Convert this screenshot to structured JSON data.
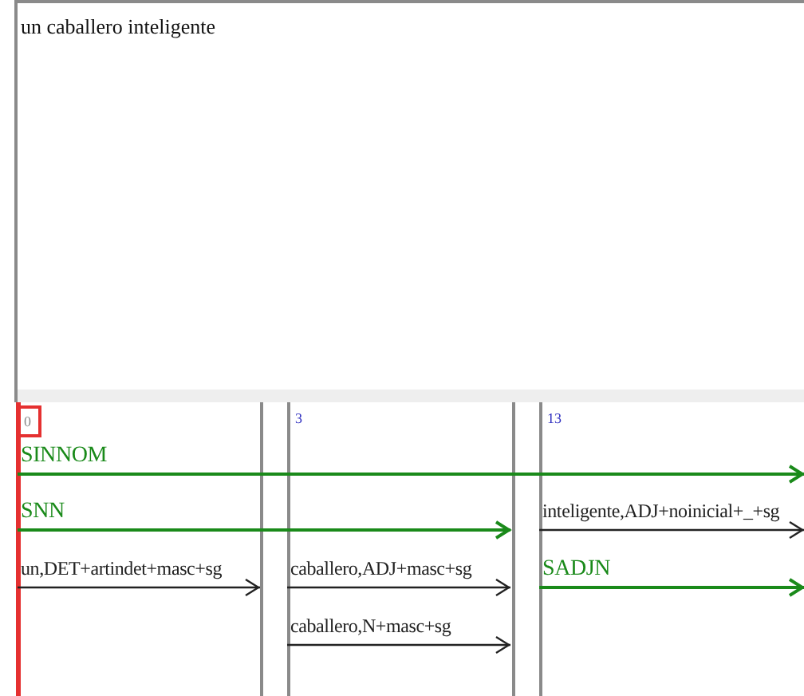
{
  "text_area": {
    "text": "un caballero inteligente"
  },
  "nodes": [
    {
      "label": "0",
      "selected": true
    },
    {
      "label": "3",
      "selected": false
    },
    {
      "label": "13",
      "selected": false
    }
  ],
  "edges": [
    {
      "label": "SINNOM",
      "kind": "syntagm"
    },
    {
      "label": "SNN",
      "kind": "syntagm"
    },
    {
      "label": "un,DET+artindet+masc+sg",
      "kind": "word"
    },
    {
      "label": "caballero,ADJ+masc+sg",
      "kind": "word"
    },
    {
      "label": "caballero,N+masc+sg",
      "kind": "word"
    },
    {
      "label": "inteligente,ADJ+noinicial+_+sg",
      "kind": "word"
    },
    {
      "label": "SADJN",
      "kind": "syntagm"
    }
  ]
}
